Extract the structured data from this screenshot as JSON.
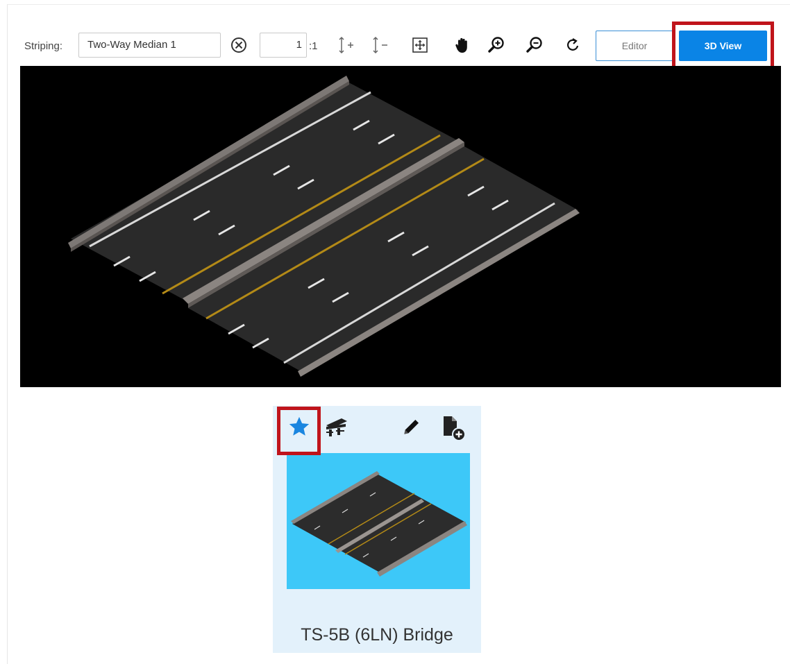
{
  "toolbar": {
    "striping_label": "Striping:",
    "striping_value": "Two-Way Median 1",
    "scale_value": "1",
    "scale_suffix": ":1",
    "editor_label": "Editor",
    "view3d_label": "3D View",
    "icons": [
      "clear-icon",
      "increase-height-icon",
      "decrease-height-icon",
      "fit-view-icon",
      "pan-hand-icon",
      "zoom-in-icon",
      "zoom-out-icon",
      "rotate-icon"
    ]
  },
  "viewport": {
    "background": "#000000",
    "description_icons": []
  },
  "card": {
    "title": "TS-5B (6LN) Bridge",
    "thumb_background": "#3dc8f8",
    "icons": [
      "favorite-star-icon",
      "bridge-icon",
      "edit-pencil-icon",
      "add-document-icon"
    ]
  },
  "colors": {
    "accent": "#0a84e6",
    "highlight": "#c0141b",
    "card_bg": "#e3f1fb"
  }
}
